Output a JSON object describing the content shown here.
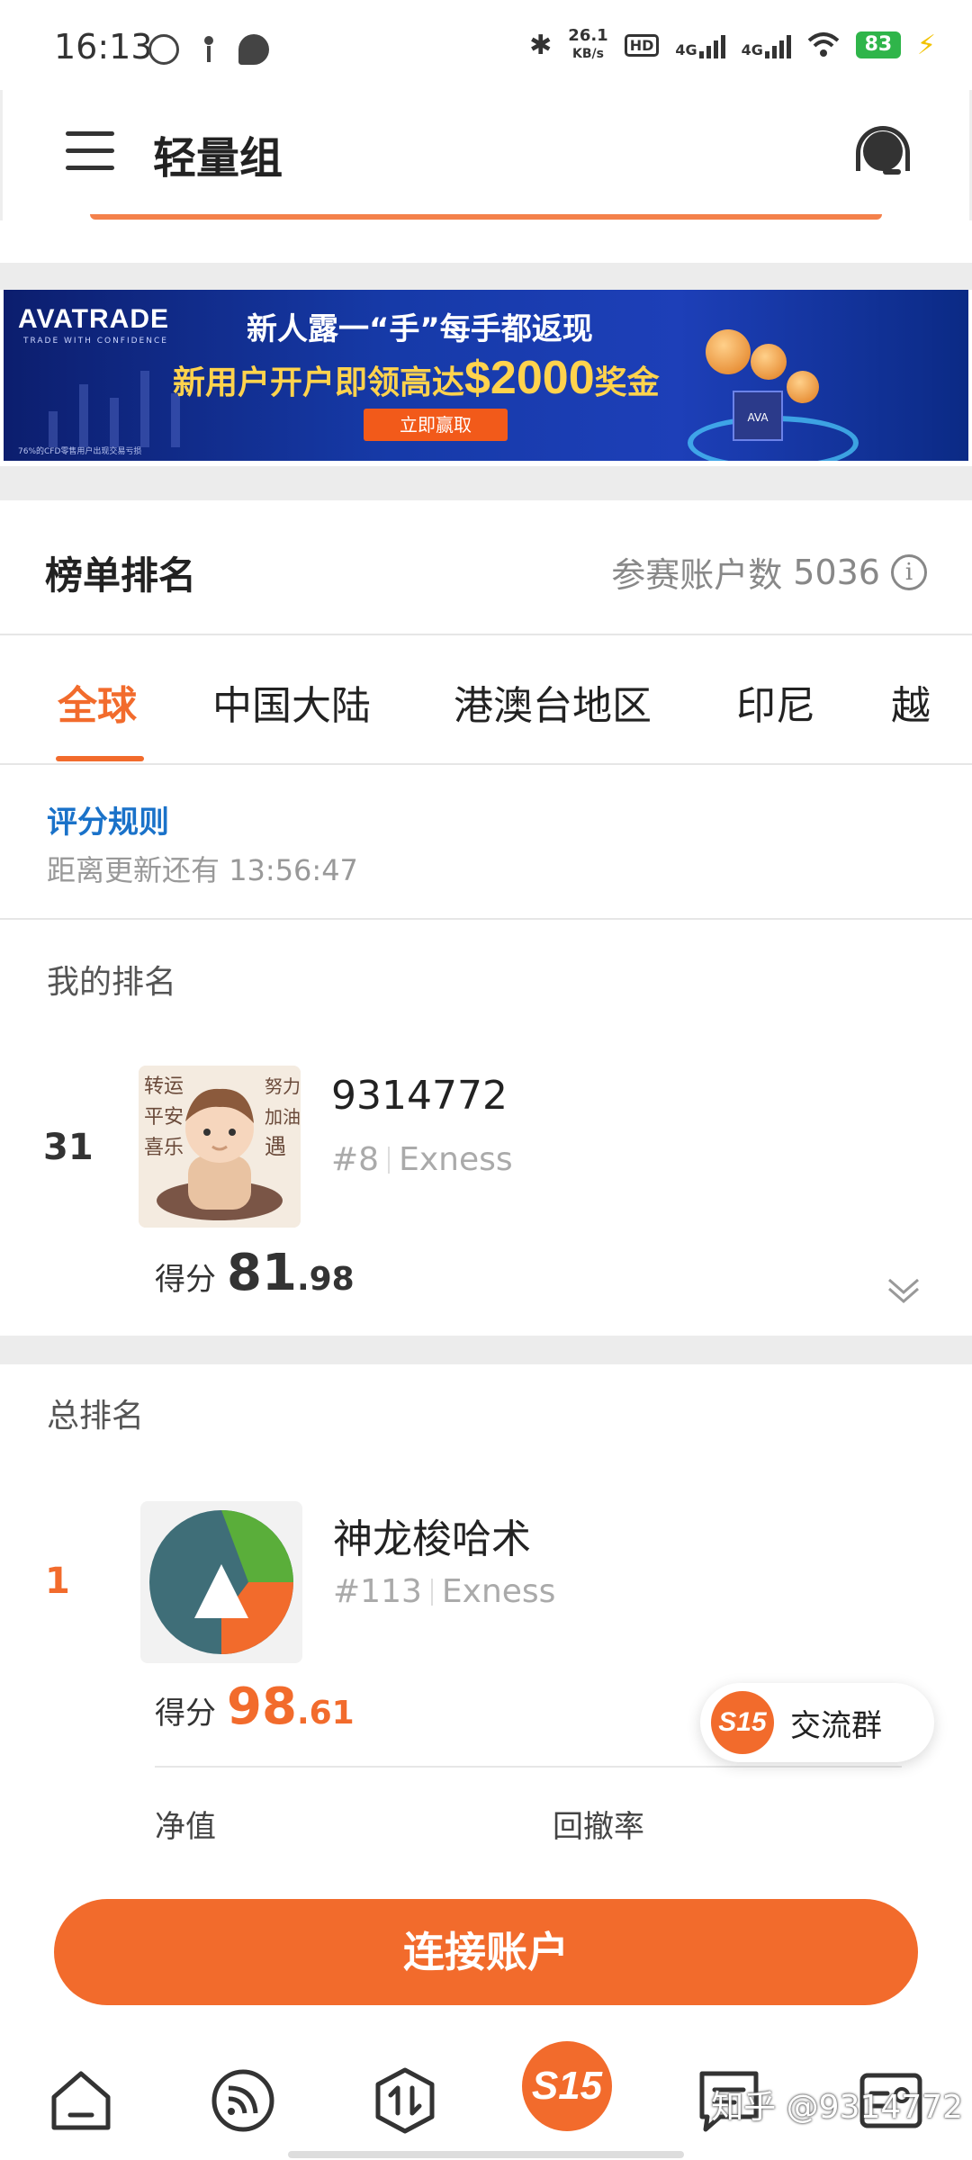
{
  "status_bar": {
    "time": "16:13",
    "net_speed_value": "26.1",
    "net_speed_unit": "KB/s",
    "hd_label": "HD",
    "signal_1": "4G",
    "signal_2": "4G",
    "battery": "83"
  },
  "app_bar": {
    "title": "轻量组"
  },
  "banner": {
    "brand": "AVATRADE",
    "brand_tagline": "TRADE WITH CONFIDENCE",
    "line1": "新人露一“手”每手都返现",
    "line2_prefix": "新用户开户即领高达",
    "line2_amount": "$2000",
    "line2_suffix": "奖金",
    "cta": "立即赢取",
    "disclaimer": "76%的CFD零售用户出现交易亏损",
    "cube_label": "AVA"
  },
  "leaderboard": {
    "title": "榜单排名",
    "participants_label": "参赛账户数",
    "participants_count": "5036",
    "tabs": [
      {
        "label": "全球",
        "active": true
      },
      {
        "label": "中国大陆",
        "active": false
      },
      {
        "label": "港澳台地区",
        "active": false
      },
      {
        "label": "印尼",
        "active": false
      },
      {
        "label": "越",
        "active": false
      }
    ],
    "rules_link": "评分规则",
    "countdown_label": "距离更新还有",
    "countdown_value": "13:56:47"
  },
  "my_ranking": {
    "section_label": "我的排名",
    "rank": "31",
    "name": "9314772",
    "account_no": "#8",
    "broker": "Exness",
    "score_label": "得分",
    "score_int": "81",
    "score_dec": ".98"
  },
  "overall_ranking": {
    "section_label": "总排名",
    "entries": [
      {
        "rank": "1",
        "name": "神龙梭哈术",
        "account_no": "#113",
        "broker": "Exness",
        "score_label": "得分",
        "score_int": "98",
        "score_dec": ".61",
        "metrics": [
          "净值",
          "回撤率"
        ]
      }
    ]
  },
  "float_chat": {
    "badge": "S15",
    "label": "交流群"
  },
  "cta": {
    "connect_label": "连接账户"
  },
  "bottom_nav": {
    "center_label": "S15",
    "watermark": "知乎 @9314772"
  },
  "colors": {
    "accent": "#f26b2c",
    "link": "#1a72c9",
    "muted": "#999999"
  }
}
